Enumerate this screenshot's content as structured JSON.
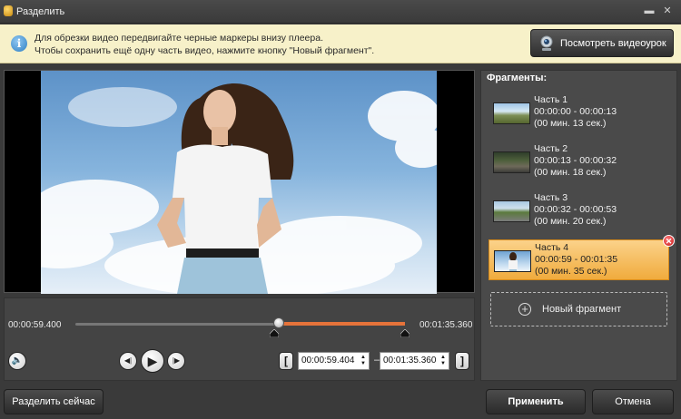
{
  "window": {
    "title": "Разделить",
    "minimize_glyph": "▬",
    "close_glyph": "✕"
  },
  "info": {
    "line1": "Для обрезки видео передвигайте черные маркеры внизу плеера.",
    "line2": "Чтобы сохранить ещё одну часть видео, нажмите кнопку \"Новый фрагмент\".",
    "icon_glyph": "i",
    "tutorial_button": "Посмотреть видеоурок"
  },
  "player": {
    "position_time": "00:00:59.400",
    "end_time": "00:01:35.360",
    "playhead_fraction": 0.62,
    "selection_start_fraction": 0.62,
    "selection_end_fraction": 1.0,
    "accent_color": "#e6733a"
  },
  "controls": {
    "volume_glyph": "🔈",
    "prev_frame_glyph": "◀|",
    "play_glyph": "▶",
    "next_frame_glyph": "|▶",
    "start_bracket": "[",
    "end_bracket": "]",
    "start_time": "00:00:59.404",
    "end_time": "00:01:35.360",
    "dash": "–",
    "spin_up": "▲",
    "spin_down": "▼"
  },
  "fragments": {
    "title": "Фрагменты:",
    "items": [
      {
        "name": "Часть 1",
        "range": "00:00:00 - 00:00:13",
        "duration": "(00 мин. 13 сек.)"
      },
      {
        "name": "Часть 2",
        "range": "00:00:13 - 00:00:32",
        "duration": "(00 мин. 18 сек.)"
      },
      {
        "name": "Часть 3",
        "range": "00:00:32 - 00:00:53",
        "duration": "(00 мин. 20 сек.)"
      },
      {
        "name": "Часть 4",
        "range": "00:00:59 - 00:01:35",
        "duration": "(00 мин. 35 сек.)"
      }
    ],
    "active_index": 3,
    "delete_glyph": "✕",
    "new_fragment_plus": "+",
    "new_fragment_label": "Новый фрагмент"
  },
  "footer": {
    "split_now": "Разделить сейчас",
    "apply": "Применить",
    "cancel": "Отмена"
  }
}
